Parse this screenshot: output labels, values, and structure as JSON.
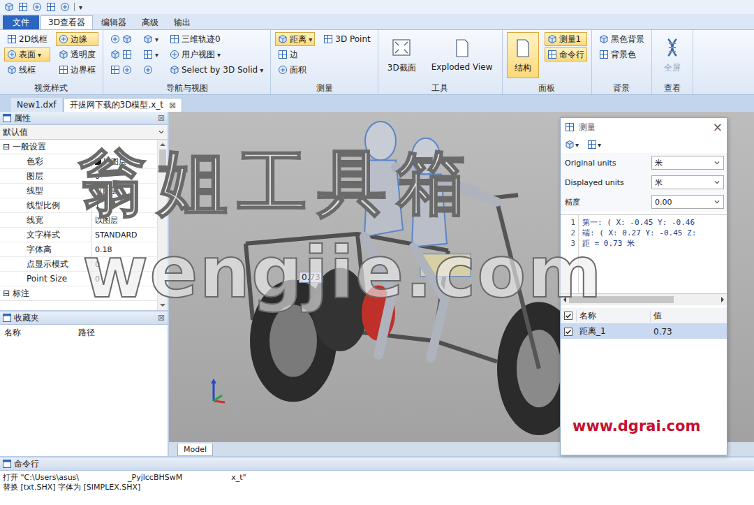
{
  "quick_toolbar": {
    "menu_glyph": "▾"
  },
  "menu_tabs": [
    {
      "label": "文件",
      "selected": false,
      "kind": "file"
    },
    {
      "label": "3D查看器",
      "selected": true,
      "kind": "tab"
    },
    {
      "label": "编辑器",
      "selected": false,
      "kind": "tab"
    },
    {
      "label": "高级",
      "selected": false,
      "kind": "tab"
    },
    {
      "label": "输出",
      "selected": false,
      "kind": "tab"
    }
  ],
  "ribbon": {
    "dropdown_glyph": "▾",
    "groups": [
      {
        "label": "视觉样式",
        "columns": [
          [
            {
              "kind": "small",
              "label": "2D线框",
              "highlighted": false,
              "dropdown": false,
              "disabled": false
            },
            {
              "kind": "small",
              "label": "表面",
              "highlighted": true,
              "dropdown": true,
              "disabled": false
            },
            {
              "kind": "small",
              "label": "线框",
              "highlighted": false,
              "dropdown": false,
              "disabled": false
            }
          ],
          [
            {
              "kind": "small",
              "label": "边缘",
              "highlighted": true,
              "dropdown": false,
              "disabled": false
            },
            {
              "kind": "small",
              "label": "透明度",
              "highlighted": false,
              "dropdown": false,
              "disabled": false
            },
            {
              "kind": "small",
              "label": "边界框",
              "highlighted": false,
              "dropdown": false,
              "disabled": false
            }
          ]
        ]
      },
      {
        "label": "导航与视图",
        "columns": [
          [
            {
              "kind": "icons",
              "label": "",
              "highlighted": false,
              "dropdown": false,
              "disabled": false
            },
            {
              "kind": "icons",
              "label": "",
              "highlighted": false,
              "dropdown": false,
              "disabled": false
            },
            {
              "kind": "icons",
              "label": "",
              "highlighted": false,
              "dropdown": false,
              "disabled": false
            }
          ],
          [
            {
              "kind": "icon",
              "label": "",
              "highlighted": false,
              "dropdown": true,
              "disabled": false
            },
            {
              "kind": "icon",
              "label": "",
              "highlighted": false,
              "dropdown": true,
              "disabled": false
            },
            {
              "kind": "icon",
              "label": "",
              "highlighted": false,
              "dropdown": false,
              "disabled": false
            }
          ],
          [
            {
              "kind": "small",
              "label": "三维轨迹0",
              "highlighted": false,
              "dropdown": false,
              "disabled": false
            },
            {
              "kind": "small",
              "label": "用户视图",
              "highlighted": false,
              "dropdown": true,
              "disabled": false
            },
            {
              "kind": "small",
              "label": "Select by 3D Solid",
              "highlighted": false,
              "dropdown": true,
              "disabled": false
            }
          ]
        ]
      },
      {
        "label": "测量",
        "columns": [
          [
            {
              "kind": "small",
              "label": "距离",
              "highlighted": true,
              "dropdown": true,
              "disabled": false
            },
            {
              "kind": "small",
              "label": "边",
              "highlighted": false,
              "dropdown": false,
              "disabled": false
            },
            {
              "kind": "small",
              "label": "面积",
              "highlighted": false,
              "dropdown": false,
              "disabled": false
            }
          ],
          [
            {
              "kind": "small",
              "label": "3D Point",
              "highlighted": false,
              "dropdown": false,
              "disabled": false
            }
          ]
        ]
      },
      {
        "label": "工具",
        "columns": [
          [
            {
              "kind": "large",
              "label": "3D截面",
              "highlighted": false,
              "dropdown": false,
              "disabled": false
            }
          ],
          [
            {
              "kind": "large",
              "label": "Exploded View",
              "highlighted": false,
              "dropdown": false,
              "disabled": false
            }
          ]
        ]
      },
      {
        "label": "面板",
        "columns": [
          [
            {
              "kind": "large",
              "label": "结构",
              "highlighted": true,
              "dropdown": false,
              "disabled": false
            }
          ],
          [
            {
              "kind": "small",
              "label": "测量1",
              "highlighted": true,
              "dropdown": false,
              "disabled": false
            },
            {
              "kind": "small",
              "label": "命令行",
              "highlighted": true,
              "dropdown": false,
              "disabled": false
            }
          ]
        ]
      },
      {
        "label": "背景",
        "columns": [
          [
            {
              "kind": "small",
              "label": "黑色背景",
              "highlighted": false,
              "dropdown": false,
              "disabled": false
            },
            {
              "kind": "small",
              "label": "背景色",
              "highlighted": false,
              "dropdown": false,
              "disabled": false
            }
          ]
        ]
      },
      {
        "label": "查看",
        "columns": [
          [
            {
              "kind": "large",
              "label": "全屏",
              "highlighted": false,
              "dropdown": false,
              "disabled": true
            }
          ]
        ]
      }
    ]
  },
  "document_tabs": [
    {
      "label": "New1.dxf",
      "selected": false,
      "closable": false
    },
    {
      "label": "开拔网下载的3D模型.x_t",
      "selected": true,
      "closable": true
    }
  ],
  "tab_close": "⊠",
  "properties": {
    "title": "属性",
    "close": "⊠",
    "preset": "默认值",
    "sections": [
      {
        "label": "一般设置",
        "expanded": true,
        "toggle": "⊟",
        "rows": [
          {
            "name": "色彩",
            "value": "以图层",
            "swatch": true
          },
          {
            "name": "图层",
            "value": "0",
            "swatch": false
          },
          {
            "name": "线型",
            "value": "以图层",
            "swatch": false
          },
          {
            "name": "线型比例",
            "value": "1",
            "swatch": false
          },
          {
            "name": "线宽",
            "value": "以图层",
            "swatch": false
          },
          {
            "name": "文字样式",
            "value": "STANDARD",
            "swatch": false
          },
          {
            "name": "字体高",
            "value": "0.18",
            "swatch": false
          },
          {
            "name": "点显示模式",
            "value": "0",
            "swatch": false
          },
          {
            "name": "Point Size",
            "value": "0",
            "swatch": false
          }
        ]
      },
      {
        "label": "标注",
        "expanded": false,
        "toggle": "⊟",
        "rows": []
      }
    ]
  },
  "favorites": {
    "title": "收藏夹",
    "close": "⊠",
    "columns": [
      "名称",
      "路径"
    ]
  },
  "viewport": {
    "measure_label": "0.73",
    "layout_tabs": [
      {
        "label": "Model",
        "selected": true
      }
    ]
  },
  "measure_panel": {
    "title": "测量",
    "close": "×",
    "dropdown_glyph": "▾",
    "fields": [
      {
        "label": "Original units",
        "value": "米"
      },
      {
        "label": "Displayed units",
        "value": "米"
      },
      {
        "label": "精度",
        "value": "0.00"
      }
    ],
    "log": [
      {
        "line": "1",
        "text": "第一: ( X: -0.45 Y: -0.46"
      },
      {
        "line": "2",
        "text": "端: ( X: 0.27 Y: -0.45 Z:"
      },
      {
        "line": "3",
        "text": "距 = 0.73 米"
      }
    ],
    "table": {
      "columns": [
        "名称",
        "值"
      ],
      "all_checked": true,
      "rows": [
        {
          "name": "距离_1",
          "value": "0.73",
          "checked": true,
          "selected": true
        }
      ]
    }
  },
  "command_line": {
    "title": "命令行",
    "lines": [
      {
        "segments": [
          "打开 \"C:\\Users\\asus\\",
          "_PyjlccBHSwM",
          "x_t\""
        ]
      },
      {
        "segments": [
          "替换 [txt.SHX] 字体为 [SIMPLEX.SHX]"
        ]
      }
    ]
  },
  "watermarks": [
    {
      "text": "翁姐工具箱",
      "kind": "cn"
    },
    {
      "text": "wengjie.com",
      "kind": "en"
    },
    {
      "text": "www.dgrai.com",
      "kind": "site"
    }
  ]
}
